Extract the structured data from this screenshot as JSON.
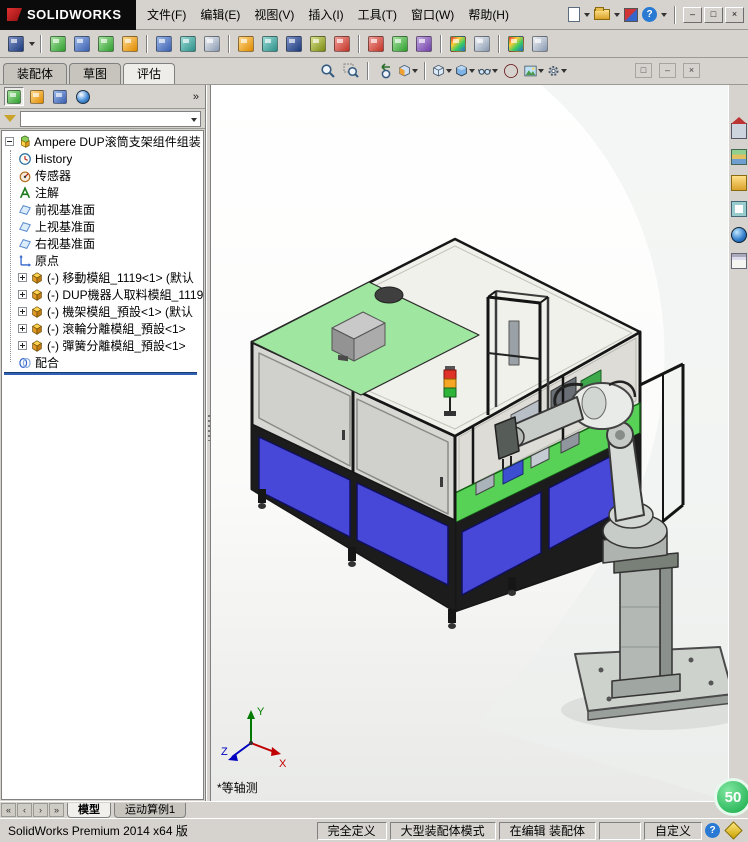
{
  "window": {
    "logo": "SOLIDWORKS",
    "menus": [
      "文件(F)",
      "编辑(E)",
      "视图(V)",
      "插入(I)",
      "工具(T)",
      "窗口(W)",
      "帮助(H)"
    ],
    "quickbar_icons": [
      "new-document",
      "open-document",
      "solidworks-file",
      "help"
    ],
    "help_glyph": "?",
    "controls": {
      "minimize": "–",
      "maximize": "□",
      "close": "×"
    }
  },
  "assembly_toolbar_icons": [
    "view-pin",
    "insert-components",
    "mate",
    "linear-component-pattern",
    "smart-fasteners",
    "move-component",
    "rotate-component",
    "show-hidden-components",
    "assembly-features",
    "reference-geometry",
    "new-motion-study",
    "bill-of-materials",
    "exploded-view",
    "interference-detection",
    "clearance-verification",
    "hole-alignment",
    "assembly-visualization",
    "performance-evaluation",
    "edit-appearance",
    "apply-scene"
  ],
  "command_tabs": {
    "tabs": [
      "装配体",
      "草图",
      "评估"
    ],
    "active_index": 2
  },
  "headsup_icons": [
    "zoom-to-fit",
    "zoom-to-area",
    "previous-view",
    "section-view",
    "view-orientation",
    "display-style",
    "hide-show-items",
    "edit-appearance",
    "apply-scene",
    "view-settings"
  ],
  "doc_window_controls": {
    "restore": "□",
    "minimize": "–",
    "close": "×"
  },
  "feature_panel": {
    "tabs": [
      "featuremanager-design-tree",
      "propertymanager",
      "configurationmanager",
      "displaymanager"
    ],
    "overflow_chevron": "»",
    "filter_value": "",
    "tree": {
      "items": [
        {
          "icon": "assembly",
          "label": "Ampere DUP滚筒支架组件组装 (默认",
          "level": 0,
          "expander": "minus"
        },
        {
          "icon": "history",
          "label": "History",
          "level": 1,
          "expander": "none"
        },
        {
          "icon": "sensors",
          "label": "传感器",
          "level": 1,
          "expander": "none"
        },
        {
          "icon": "annotations",
          "label": "注解",
          "level": 1,
          "expander": "none"
        },
        {
          "icon": "plane",
          "label": "前视基准面",
          "level": 1,
          "expander": "none"
        },
        {
          "icon": "plane",
          "label": "上视基准面",
          "level": 1,
          "expander": "none"
        },
        {
          "icon": "plane",
          "label": "右视基准面",
          "level": 1,
          "expander": "none"
        },
        {
          "icon": "origin",
          "label": "原点",
          "level": 1,
          "expander": "none"
        },
        {
          "icon": "component",
          "label": "(-) 移動模組_1119<1> (默认",
          "level": 1,
          "expander": "plus"
        },
        {
          "icon": "component",
          "label": "(-) DUP機器人取料模組_1119",
          "level": 1,
          "expander": "plus"
        },
        {
          "icon": "component",
          "label": "(-) 機架模組_預設<1> (默认",
          "level": 1,
          "expander": "plus"
        },
        {
          "icon": "component",
          "label": "(-) 滾輪分離模組_預設<1>",
          "level": 1,
          "expander": "plus"
        },
        {
          "icon": "component",
          "label": "(-) 彈簧分離模組_預設<1>",
          "level": 1,
          "expander": "plus"
        },
        {
          "icon": "mates",
          "label": "配合",
          "level": 1,
          "expander": "none"
        }
      ],
      "rollback_bar": true
    }
  },
  "taskpane_icons": [
    "solidworks-resources",
    "design-library",
    "file-explorer",
    "view-palette",
    "appearances",
    "custom-properties"
  ],
  "viewport": {
    "view_label": "*等轴测",
    "triad": {
      "x": "X",
      "y": "Y",
      "z": "Z"
    },
    "model_colors": {
      "top_panel_green": "#9fe6a0",
      "lower_panel_blue": "#4747d8",
      "work_surface_green": "#57d257",
      "frame_black": "#161616",
      "robot_gray": "#d2d6d4"
    }
  },
  "doc_tabs": {
    "nav": [
      "«",
      "‹",
      "›",
      "»"
    ],
    "tabs": [
      "模型",
      "运动算例1"
    ],
    "active_index": 0
  },
  "statusbar": {
    "product": "SolidWorks Premium 2014 x64 版",
    "segments": [
      "完全定义",
      "大型装配体模式",
      "在编辑 装配体",
      "自定义"
    ],
    "help_glyph": "?"
  },
  "badge": {
    "text": "50",
    "color": "#12a845"
  }
}
